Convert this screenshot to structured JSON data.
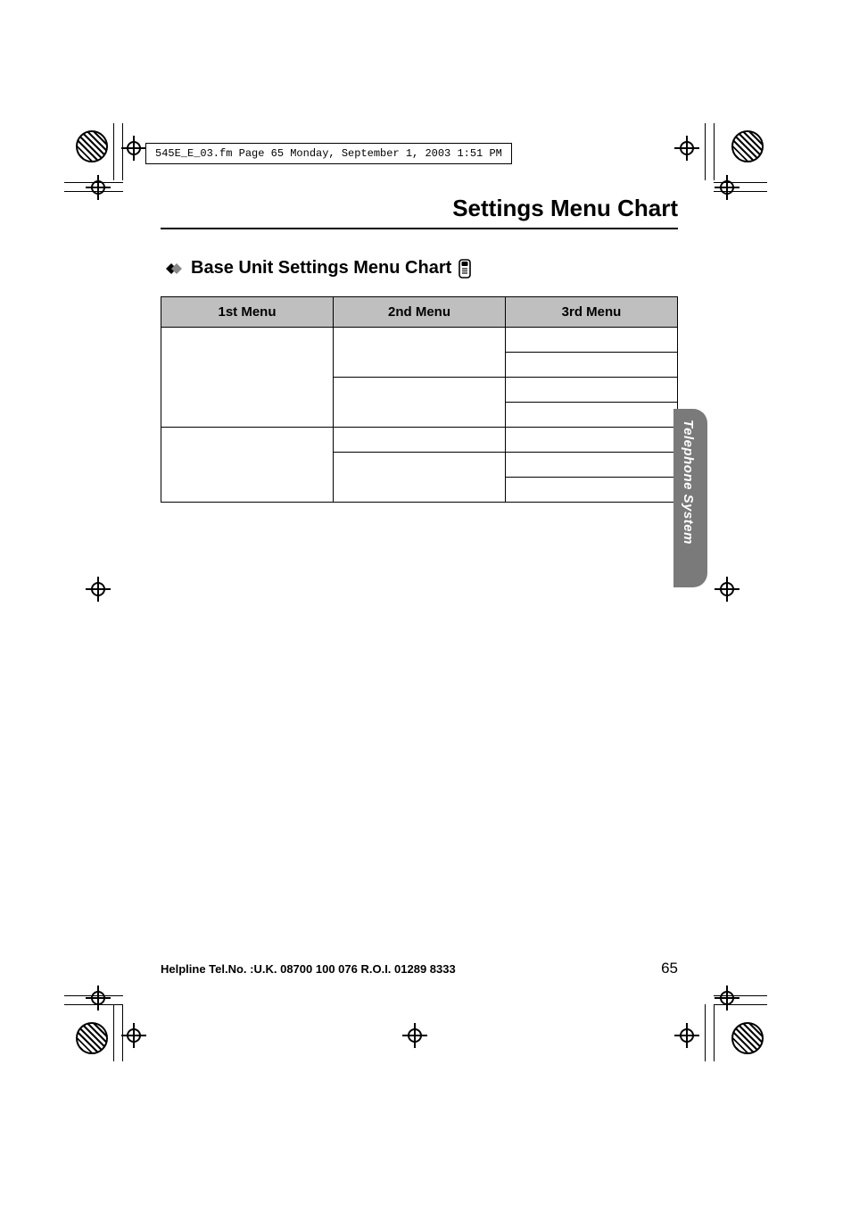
{
  "fm_header": "545E_E_03.fm  Page 65  Monday, September 1, 2003  1:51 PM",
  "section_title": "Settings Menu Chart",
  "subsection_title": "Base Unit Settings Menu Chart",
  "table_headers": {
    "c1": "1st Menu",
    "c2": "2nd Menu",
    "c3": "3rd Menu"
  },
  "side_tab": "Telephone System",
  "footer_helpline": "Helpline Tel.No. :U.K. 08700 100 076  R.O.I. 01289 8333",
  "page_number": "65"
}
